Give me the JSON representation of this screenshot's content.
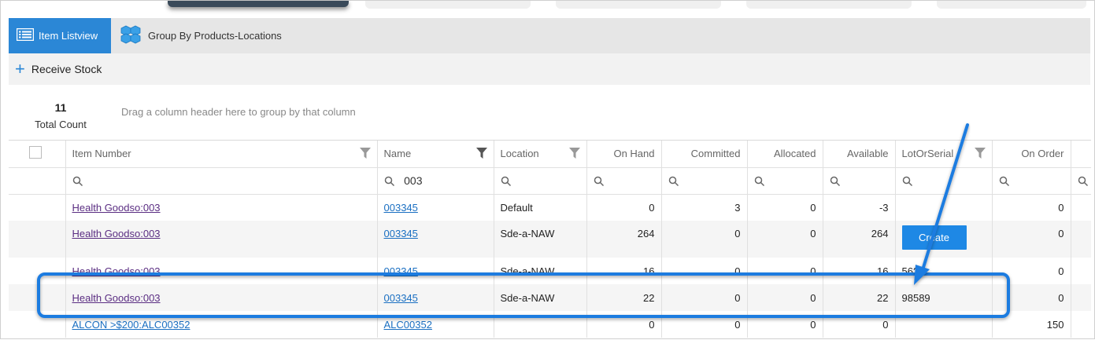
{
  "tabs": [
    {
      "label": "Item Listview",
      "icon": "list-icon",
      "active": true
    },
    {
      "label": "Group By Products-Locations",
      "icon": "boxes-icon",
      "active": false
    }
  ],
  "toolbar": {
    "receive_label": "Receive Stock"
  },
  "summary": {
    "count": "11",
    "count_label": "Total Count",
    "group_hint": "Drag a column header here to group by that column"
  },
  "columns": [
    "Item Number",
    "Name",
    "Location",
    "On Hand",
    "Committed",
    "Allocated",
    "Available",
    "LotOrSerial",
    "On Order"
  ],
  "filters": {
    "name": "003"
  },
  "rows": [
    {
      "item": "Health Goodso:003",
      "name": "003345",
      "location": "Default",
      "on_hand": "0",
      "committed": "3",
      "allocated": "0",
      "available": "-3",
      "lot": "",
      "on_order": "0"
    },
    {
      "item": "Health Goodso:003",
      "name": "003345",
      "location": "Sde-a-NAW",
      "on_hand": "264",
      "committed": "0",
      "allocated": "0",
      "available": "264",
      "lot": "Create",
      "on_order": "0"
    },
    {
      "item": "Health Goodso:003",
      "name": "003345",
      "location": "Sde-a-NAW",
      "on_hand": "16",
      "committed": "0",
      "allocated": "0",
      "available": "16",
      "lot": "56??",
      "on_order": "0"
    },
    {
      "item": "Health Goodso:003",
      "name": "003345",
      "location": "Sde-a-NAW",
      "on_hand": "22",
      "committed": "0",
      "allocated": "0",
      "available": "22",
      "lot": "98589",
      "on_order": "0"
    },
    {
      "item": "ALCON >$200:ALC00352",
      "name": "ALC00352",
      "location": "",
      "on_hand": "0",
      "committed": "0",
      "allocated": "0",
      "available": "0",
      "lot": "",
      "on_order": "150"
    }
  ],
  "colors": {
    "accent": "#2b87d6",
    "annotation": "#1e7be0",
    "link": "#5a2d82"
  }
}
